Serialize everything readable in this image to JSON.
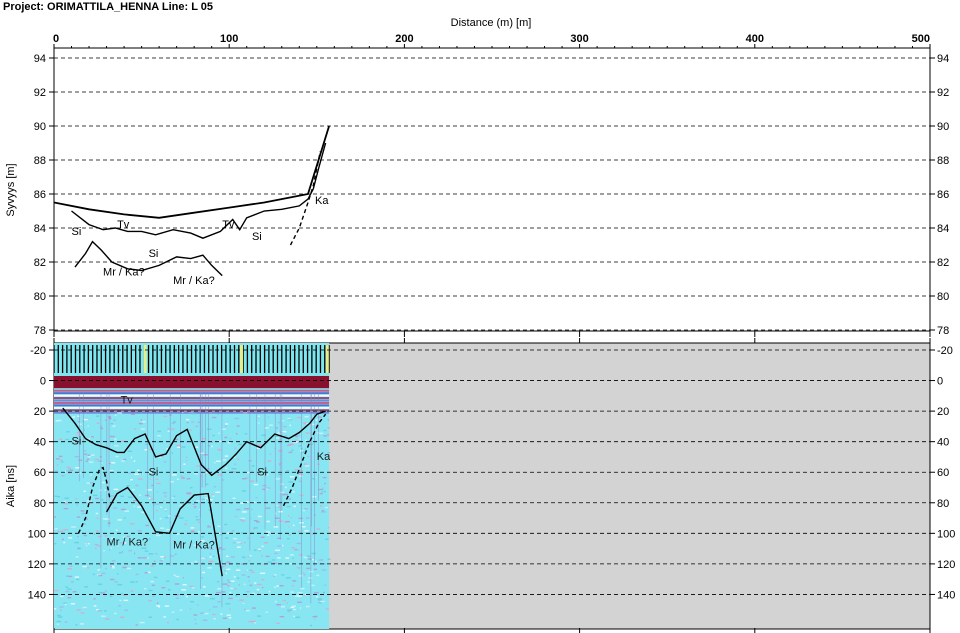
{
  "header": {
    "title": "Project: ORIMATTILA_HENNA  Line: L 05"
  },
  "chart_data": [
    {
      "type": "line",
      "panel": "depth-profile",
      "xlabel": "Distance (m) [m]",
      "ylabel": "Syvyys [m]",
      "xlim": [
        0,
        500
      ],
      "ylim": [
        78,
        94
      ],
      "x_ticks": [
        0,
        100,
        200,
        300,
        400,
        500
      ],
      "y_ticks": [
        94,
        92,
        90,
        88,
        86,
        84,
        82,
        80,
        78
      ],
      "grid": "horizontal-dashed",
      "series": [
        {
          "role": "ground-surface",
          "style": "solid-thick",
          "x": [
            0,
            20,
            40,
            60,
            80,
            100,
            120,
            145,
            157
          ],
          "y": [
            85.5,
            85.1,
            84.8,
            84.6,
            84.9,
            85.2,
            85.5,
            86.0,
            90.0
          ]
        },
        {
          "role": "interface-upper",
          "style": "solid",
          "x": [
            10,
            20,
            28,
            35,
            42,
            50,
            58,
            68,
            78,
            85,
            95,
            102,
            106,
            110,
            120,
            130,
            140,
            145,
            148,
            151,
            155
          ],
          "y": [
            85.0,
            84.2,
            83.9,
            84.0,
            83.8,
            83.8,
            83.6,
            83.9,
            83.7,
            83.4,
            83.8,
            84.5,
            83.9,
            84.6,
            85.0,
            85.1,
            85.3,
            85.7,
            86.3,
            87.5,
            89.0
          ]
        },
        {
          "role": "interface-right-dashed",
          "style": "dashed",
          "x": [
            135,
            140,
            145,
            148,
            150,
            152
          ],
          "y": [
            83.0,
            84.0,
            85.5,
            86.5,
            87.5,
            88.5
          ]
        },
        {
          "role": "interface-lower",
          "style": "solid",
          "x": [
            12,
            18,
            22,
            27,
            33,
            42,
            50,
            60,
            70,
            78,
            85,
            90,
            96
          ],
          "y": [
            81.7,
            82.5,
            83.2,
            82.7,
            82.0,
            81.6,
            81.5,
            81.8,
            82.3,
            82.2,
            82.4,
            81.8,
            81.2
          ]
        }
      ],
      "annotations": [
        {
          "text": "Si",
          "x": 10,
          "y": 83.6
        },
        {
          "text": "Tv",
          "x": 36,
          "y": 84.0
        },
        {
          "text": "Tv",
          "x": 96,
          "y": 84.0
        },
        {
          "text": "Si",
          "x": 54,
          "y": 82.3
        },
        {
          "text": "Si",
          "x": 113,
          "y": 83.3
        },
        {
          "text": "Ka",
          "x": 149,
          "y": 85.4
        },
        {
          "text": "Mr / Ka?",
          "x": 28,
          "y": 81.2
        },
        {
          "text": "Mr / Ka?",
          "x": 68,
          "y": 80.7
        }
      ]
    },
    {
      "type": "heatmap",
      "panel": "radargram",
      "xlabel": "Distance (m) [m]",
      "ylabel": "Aika [ns]",
      "xlim": [
        0,
        500
      ],
      "ylim": [
        -20,
        160
      ],
      "data_extent_x": [
        0,
        157
      ],
      "y_ticks": [
        -20,
        0,
        20,
        40,
        60,
        80,
        100,
        120,
        140
      ],
      "grid": "horizontal-dashed",
      "series": [
        {
          "role": "interface-upper",
          "style": "solid",
          "x": [
            5,
            12,
            18,
            24,
            30,
            36,
            40,
            46,
            52,
            58,
            64,
            70,
            76,
            84,
            90,
            98,
            104,
            110,
            118,
            126,
            134,
            140,
            146,
            150,
            155
          ],
          "y": [
            18,
            28,
            38,
            42,
            44,
            47,
            47,
            38,
            35,
            50,
            48,
            36,
            32,
            55,
            62,
            55,
            48,
            40,
            44,
            35,
            38,
            34,
            28,
            22,
            20
          ]
        },
        {
          "role": "interface-right-dashed",
          "style": "dashed",
          "x": [
            131,
            136,
            141,
            146,
            151,
            155
          ],
          "y": [
            82,
            70,
            55,
            40,
            28,
            22
          ]
        },
        {
          "role": "interface-lower-left",
          "style": "dashed",
          "x": [
            14,
            18,
            22,
            26,
            28,
            30,
            32
          ],
          "y": [
            100,
            90,
            70,
            58,
            57,
            66,
            78
          ]
        },
        {
          "role": "interface-lower",
          "style": "solid",
          "x": [
            30,
            36,
            42,
            50,
            58,
            66,
            72,
            80,
            88,
            96
          ],
          "y": [
            86,
            74,
            70,
            82,
            99,
            100,
            84,
            75,
            74,
            128
          ]
        }
      ],
      "annotations": [
        {
          "text": "Tv",
          "x": 38,
          "y": 15
        },
        {
          "text": "Si",
          "x": 10,
          "y": 42
        },
        {
          "text": "Si",
          "x": 54,
          "y": 62
        },
        {
          "text": "Si",
          "x": 116,
          "y": 62
        },
        {
          "text": "Ka",
          "x": 150,
          "y": 52
        },
        {
          "text": "Mr / Ka?",
          "x": 30,
          "y": 108
        },
        {
          "text": "Mr / Ka?",
          "x": 68,
          "y": 110
        }
      ]
    }
  ],
  "colors": {
    "plot_bg": "#ffffff",
    "empty_bg": "#d3d3d3",
    "grid": "#000000",
    "radar_base": "#88e6f2",
    "marker_band": "#7ee6f0",
    "marker_highlight": "#e6f08a",
    "surface_band": "#8a1030",
    "line": "#000000"
  }
}
